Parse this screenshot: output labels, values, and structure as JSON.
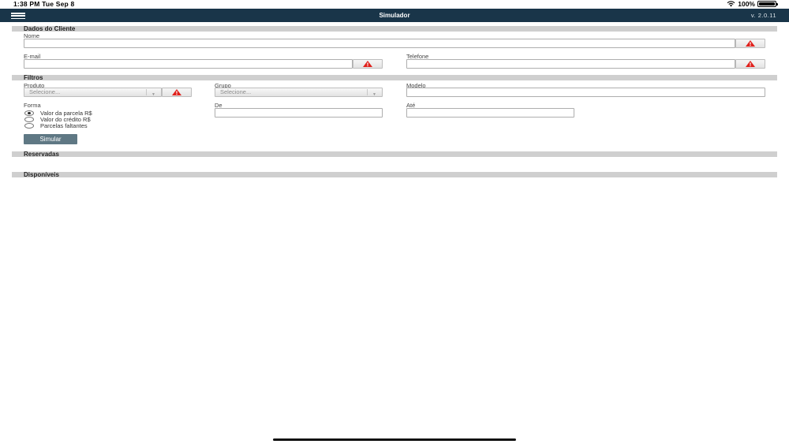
{
  "status_bar": {
    "time": "1:38 PM   Tue Sep 8",
    "battery": "100%"
  },
  "navbar": {
    "title": "Simulador",
    "version": "v. 2.0.11"
  },
  "sections": {
    "cliente": "Dados do Cliente",
    "filtros": "Filtros",
    "reservadas": "Reservadas",
    "disponiveis": "Disponíveis"
  },
  "cliente": {
    "nome_label": "Nome",
    "nome_value": "",
    "email_label": "E-mail",
    "email_value": "",
    "telefone_label": "Telefone",
    "telefone_value": ""
  },
  "filtros": {
    "produto_label": "Produto",
    "produto_value": "Selecione...",
    "grupo_label": "Grupo",
    "grupo_value": "Selecione...",
    "modelo_label": "Modelo",
    "modelo_value": "",
    "forma_label": "Forma",
    "forma_options": [
      "Valor da parcela R$",
      "Valor do crédito R$",
      "Parcelas faltantes"
    ],
    "forma_selected": "Valor da parcela R$",
    "de_label": "De",
    "de_value": "",
    "ate_label": "Até",
    "ate_value": "",
    "simulate_label": "Simular"
  },
  "colors": {
    "navbar": "#193549",
    "warning": "#e0201b",
    "button": "#5f7884",
    "section": "#cfcfcf"
  },
  "icons": {
    "menu": "hamburger-menu-icon",
    "warning": "warning-triangle-icon",
    "wifi": "wifi-icon",
    "battery": "battery-icon"
  }
}
